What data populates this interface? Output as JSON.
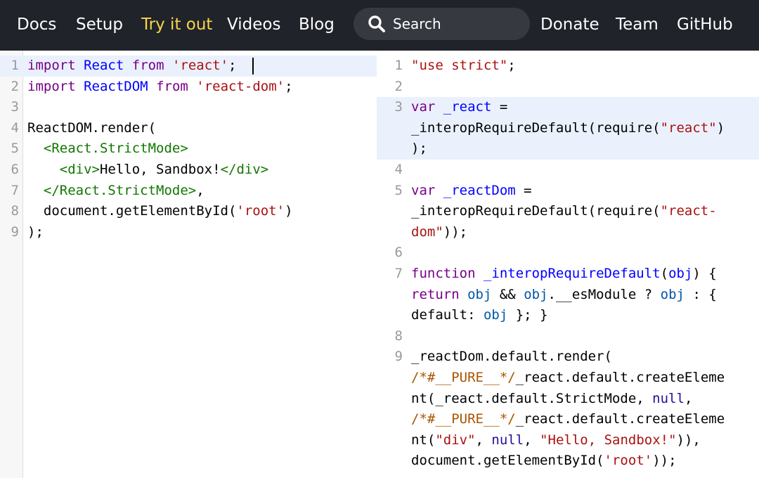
{
  "nav": {
    "links": [
      "Docs",
      "Setup",
      "Try it out",
      "Videos",
      "Blog",
      "Donate",
      "Team",
      "GitHub"
    ],
    "active": "Try it out",
    "search_placeholder": "Search"
  },
  "colors": {
    "nav_bg": "#20232a",
    "nav_active": "#f9d54b",
    "search_bg": "#373940",
    "keyword": "#770088",
    "def": "#0000ff",
    "string": "#aa1111",
    "tag": "#117700",
    "comment": "#aa5500",
    "atom": "#221199",
    "highlight": "#eaf1fd"
  },
  "input_editor": {
    "lines": [
      {
        "n": "1",
        "tokens": [
          [
            "import",
            "kw"
          ],
          [
            " ",
            ""
          ],
          [
            "React",
            "df"
          ],
          [
            " ",
            ""
          ],
          [
            "from",
            "kw"
          ],
          [
            " ",
            ""
          ],
          [
            "'react'",
            "st"
          ],
          [
            ";",
            ""
          ]
        ]
      },
      {
        "n": "2",
        "tokens": [
          [
            "import",
            "kw"
          ],
          [
            " ",
            ""
          ],
          [
            "ReactDOM",
            "df"
          ],
          [
            " ",
            ""
          ],
          [
            "from",
            "kw"
          ],
          [
            " ",
            ""
          ],
          [
            "'react-dom'",
            "st"
          ],
          [
            ";",
            ""
          ]
        ]
      },
      {
        "n": "3",
        "tokens": []
      },
      {
        "n": "4",
        "tokens": [
          [
            "ReactDOM.render(",
            ""
          ]
        ]
      },
      {
        "n": "5",
        "tokens": [
          [
            "  ",
            ""
          ],
          [
            "<React.StrictMode>",
            "tg"
          ]
        ]
      },
      {
        "n": "6",
        "tokens": [
          [
            "    ",
            ""
          ],
          [
            "<div>",
            "tg"
          ],
          [
            "Hello, Sandbox!",
            ""
          ],
          [
            "</div>",
            "tg"
          ]
        ]
      },
      {
        "n": "7",
        "tokens": [
          [
            "  ",
            ""
          ],
          [
            "</React.StrictMode>",
            "tg"
          ],
          [
            ",",
            ""
          ]
        ]
      },
      {
        "n": "8",
        "tokens": [
          [
            "  document.getElementById(",
            ""
          ],
          [
            "'root'",
            "st"
          ],
          [
            ")",
            ""
          ]
        ]
      },
      {
        "n": "9",
        "tokens": [
          [
            ");",
            ""
          ]
        ]
      }
    ]
  },
  "output_editor": {
    "lines": [
      {
        "n": "1",
        "hl": false,
        "rows": [
          [
            [
              "\"use strict\"",
              "st"
            ],
            [
              ";",
              ""
            ]
          ]
        ]
      },
      {
        "n": "2",
        "hl": false,
        "rows": [
          []
        ]
      },
      {
        "n": "3",
        "hl": true,
        "rows": [
          [
            [
              "var",
              "kw"
            ],
            [
              " ",
              ""
            ],
            [
              "_react",
              "df"
            ],
            [
              " =",
              ""
            ]
          ],
          [
            [
              "_interopRequireDefault(require(",
              ""
            ],
            [
              "\"react\"",
              "st"
            ],
            [
              ")",
              ""
            ]
          ],
          [
            [
              ");",
              ""
            ]
          ]
        ]
      },
      {
        "n": "4",
        "hl": false,
        "rows": [
          []
        ]
      },
      {
        "n": "5",
        "hl": false,
        "rows": [
          [
            [
              "var",
              "kw"
            ],
            [
              " ",
              ""
            ],
            [
              "_reactDom",
              "df"
            ],
            [
              " =",
              ""
            ]
          ],
          [
            [
              "_interopRequireDefault(require(",
              ""
            ],
            [
              "\"react-",
              "st"
            ]
          ],
          [
            [
              "dom\"",
              "st"
            ],
            [
              "));",
              ""
            ]
          ]
        ]
      },
      {
        "n": "6",
        "hl": false,
        "rows": [
          []
        ]
      },
      {
        "n": "7",
        "hl": false,
        "rows": [
          [
            [
              "function",
              "kw"
            ],
            [
              " ",
              ""
            ],
            [
              "_interopRequireDefault",
              "df"
            ],
            [
              "(",
              ""
            ],
            [
              "obj",
              "df"
            ],
            [
              ") {",
              ""
            ]
          ],
          [
            [
              "return",
              "kw"
            ],
            [
              " ",
              ""
            ],
            [
              "obj",
              "vd"
            ],
            [
              " && ",
              ""
            ],
            [
              "obj",
              "vd"
            ],
            [
              ".__esModule ? ",
              ""
            ],
            [
              "obj",
              "vd"
            ],
            [
              " : {",
              ""
            ]
          ],
          [
            [
              "default: ",
              ""
            ],
            [
              "obj",
              "vd"
            ],
            [
              " }; }",
              ""
            ]
          ]
        ]
      },
      {
        "n": "8",
        "hl": false,
        "rows": [
          []
        ]
      },
      {
        "n": "9",
        "hl": false,
        "rows": [
          [
            [
              "_reactDom.default.render(",
              ""
            ]
          ],
          [
            [
              "/*#__PURE__*/",
              "cm"
            ],
            [
              "_react.default.createEleme",
              ""
            ]
          ],
          [
            [
              "nt(_react.default.StrictMode, ",
              ""
            ],
            [
              "null",
              "at"
            ],
            [
              ",",
              ""
            ]
          ],
          [
            [
              "/*#__PURE__*/",
              "cm"
            ],
            [
              "_react.default.createEleme",
              ""
            ]
          ],
          [
            [
              "nt(",
              ""
            ],
            [
              "\"div\"",
              "st"
            ],
            [
              ", ",
              ""
            ],
            [
              "null",
              "at"
            ],
            [
              ", ",
              ""
            ],
            [
              "\"Hello, Sandbox!\"",
              "st"
            ],
            [
              ")),",
              ""
            ]
          ],
          [
            [
              "document.getElementById(",
              ""
            ],
            [
              "'root'",
              "st"
            ],
            [
              "));",
              ""
            ]
          ]
        ]
      }
    ]
  }
}
